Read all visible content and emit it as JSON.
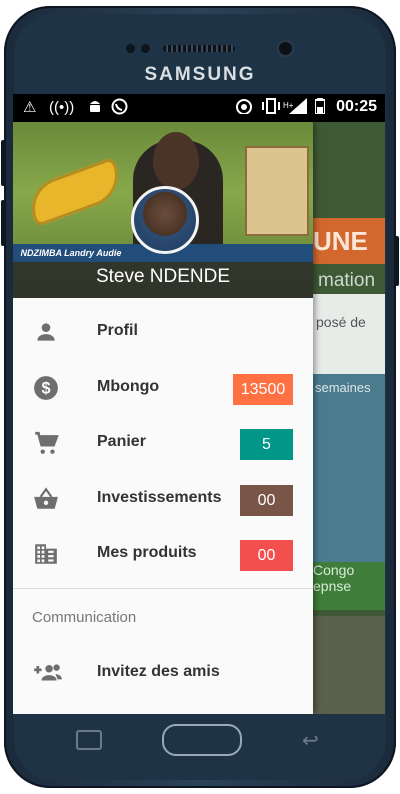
{
  "device": {
    "brand": "SAMSUNG"
  },
  "status_bar": {
    "time": "00:25",
    "icons": [
      "warning-icon",
      "hotspot-icon",
      "android-icon",
      "whatsapp-icon",
      "wifi-icon",
      "vibrate-icon",
      "signal-icon",
      "battery-icon"
    ],
    "network_label": "H+"
  },
  "drawer": {
    "header": {
      "user_name": "Steve NDENDE",
      "image_caption": "NDZIMBA Landry Audie"
    },
    "items": [
      {
        "label": "Profil",
        "icon": "person-icon"
      },
      {
        "label": "Mbongo",
        "icon": "dollar-icon",
        "badge": "13500",
        "badge_color": "#ff7043"
      },
      {
        "label": "Panier",
        "icon": "cart-icon",
        "badge": "5",
        "badge_color": "#009688"
      },
      {
        "label": "Investissements",
        "icon": "basket-icon",
        "badge": "00",
        "badge_color": "#795548"
      },
      {
        "label": "Mes produits",
        "icon": "business-icon",
        "badge": "00",
        "badge_color": "#f44f4f"
      }
    ],
    "section_title": "Communication",
    "invite": {
      "label": "Invitez des amis",
      "icon": "group-add-icon"
    }
  },
  "background": {
    "orange_text": "UNE",
    "text1": "mation",
    "text2": "posé de",
    "photo_text": "semaines",
    "green_text": "Congo\nepnse"
  }
}
